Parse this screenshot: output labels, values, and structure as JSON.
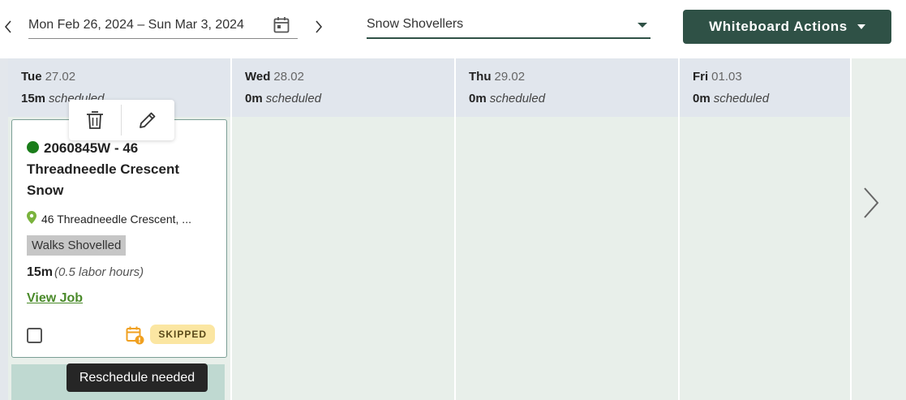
{
  "toolbar": {
    "date_range": "Mon Feb 26, 2024 – Sun Mar 3, 2024",
    "crew_select": "Snow Shovellers",
    "actions_label": "Whiteboard Actions"
  },
  "days": [
    {
      "name": "Tue",
      "date": "27.02",
      "duration": "15m",
      "label": "scheduled"
    },
    {
      "name": "Wed",
      "date": "28.02",
      "duration": "0m",
      "label": "scheduled"
    },
    {
      "name": "Thu",
      "date": "29.02",
      "duration": "0m",
      "label": "scheduled"
    },
    {
      "name": "Fri",
      "date": "01.03",
      "duration": "0m",
      "label": "scheduled"
    }
  ],
  "job_card": {
    "title": "2060845W - 46 Threadneedle Crescent Snow",
    "status_color": "#1a7d1a",
    "address": "46 Threadneedle Crescent, ...",
    "tag": "Walks Shovelled",
    "duration": "15m",
    "labor_hours": "(0.5 labor hours)",
    "view_job_label": "View Job",
    "status_badge": "SKIPPED"
  },
  "tooltip": "Reschedule needed",
  "colors": {
    "brand": "#2f5146",
    "badge_bg": "#fbe6a2",
    "link": "#4a8a2a",
    "warning_icon": "#f0a020"
  },
  "icons": {
    "prev": "chevron-left-icon",
    "next": "chevron-right-icon",
    "calendar": "calendar-icon",
    "delete": "trash-icon",
    "edit": "pencil-icon",
    "location": "map-pin-icon",
    "reschedule": "calendar-warning-icon",
    "scroll_next": "chevron-right-icon"
  }
}
